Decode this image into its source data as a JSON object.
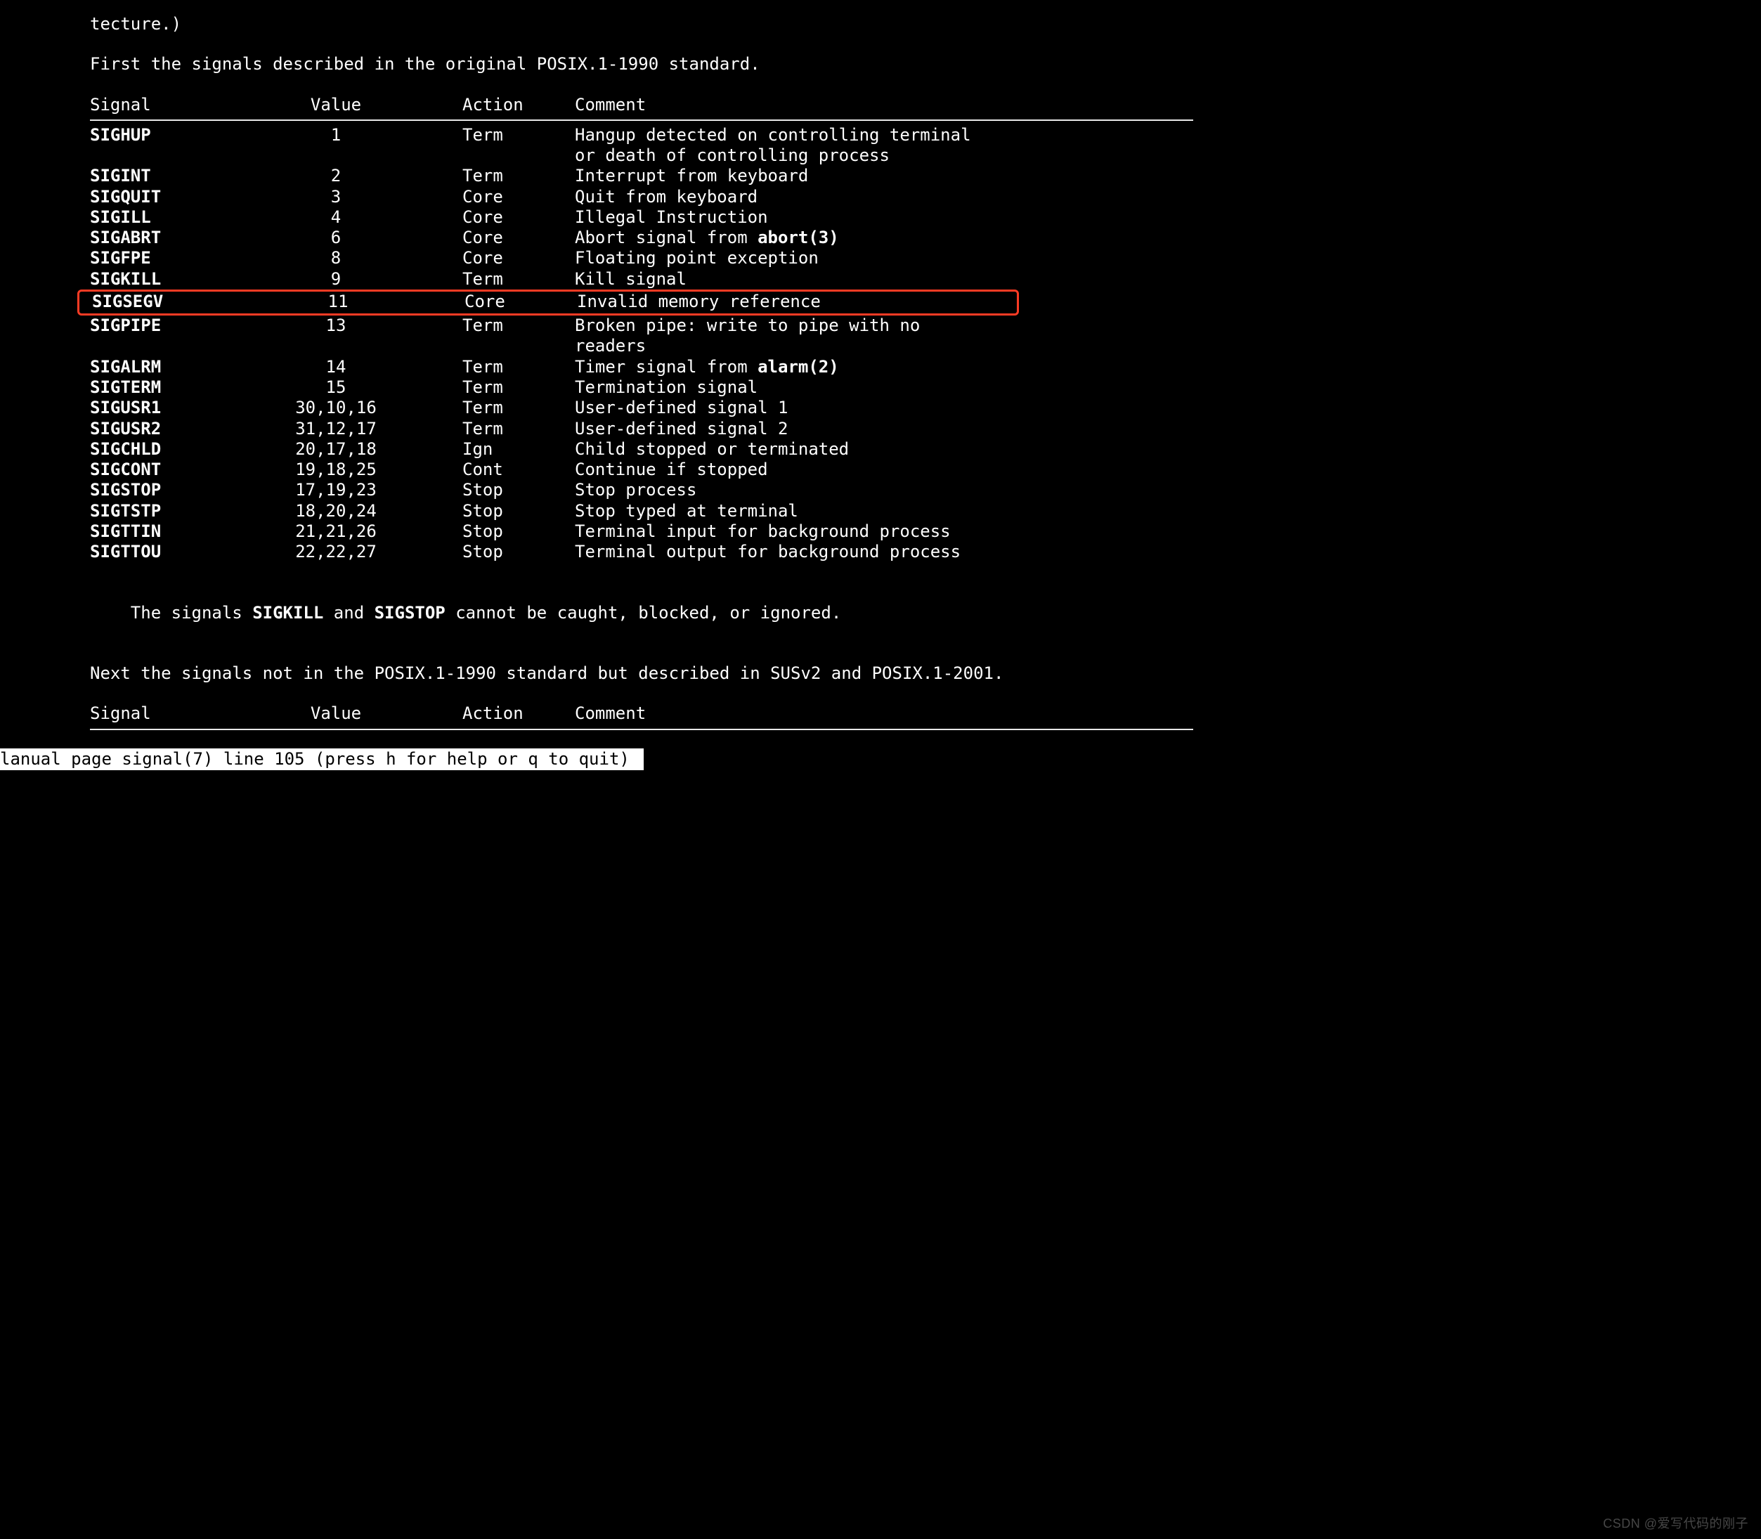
{
  "top_line": "tecture.)",
  "intro": "First the signals described in the original POSIX.1-1990 standard.",
  "headers": {
    "signal": "Signal",
    "value": "Value",
    "action": "Action",
    "comment": "Comment"
  },
  "rows": [
    {
      "signal": "SIGHUP",
      "value": "1",
      "action": "Term",
      "comment": "Hangup detected on controlling terminal",
      "comment2": "or death of controlling process",
      "bold": true
    },
    {
      "signal": "SIGINT",
      "value": "2",
      "action": "Term",
      "comment": "Interrupt from keyboard",
      "bold": true
    },
    {
      "signal": "SIGQUIT",
      "value": "3",
      "action": "Core",
      "comment": "Quit from keyboard",
      "bold": true
    },
    {
      "signal": "SIGILL",
      "value": "4",
      "action": "Core",
      "comment": "Illegal Instruction",
      "bold": true
    },
    {
      "signal": "SIGABRT",
      "value": "6",
      "action": "Core",
      "comment_pre": "Abort signal from ",
      "comment_bold": "abort(3)",
      "bold": true
    },
    {
      "signal": "SIGFPE",
      "value": "8",
      "action": "Core",
      "comment": "Floating point exception",
      "bold": true
    },
    {
      "signal": "SIGKILL",
      "value": "9",
      "action": "Term",
      "comment": "Kill signal",
      "bold": true
    },
    {
      "signal": "SIGSEGV",
      "value": "11",
      "action": "Core",
      "comment": "Invalid memory reference",
      "bold": true,
      "highlight": true
    },
    {
      "signal": "SIGPIPE",
      "value": "13",
      "action": "Term",
      "comment": "Broken pipe: write to pipe with no",
      "comment2": "readers",
      "bold": true
    },
    {
      "signal": "SIGALRM",
      "value": "14",
      "action": "Term",
      "comment_pre": "Timer signal from ",
      "comment_bold": "alarm(2)",
      "bold": true
    },
    {
      "signal": "SIGTERM",
      "value": "15",
      "action": "Term",
      "comment": "Termination signal",
      "bold": true
    },
    {
      "signal": "SIGUSR1",
      "value": "30,10,16",
      "action": "Term",
      "comment": "User-defined signal 1",
      "bold": true
    },
    {
      "signal": "SIGUSR2",
      "value": "31,12,17",
      "action": "Term",
      "comment": "User-defined signal 2",
      "bold": true
    },
    {
      "signal": "SIGCHLD",
      "value": "20,17,18",
      "action": "Ign",
      "comment": "Child stopped or terminated",
      "bold": true
    },
    {
      "signal": "SIGCONT",
      "value": "19,18,25",
      "action": "Cont",
      "comment": "Continue if stopped",
      "bold": true
    },
    {
      "signal": "SIGSTOP",
      "value": "17,19,23",
      "action": "Stop",
      "comment": "Stop process",
      "bold": true
    },
    {
      "signal": "SIGTSTP",
      "value": "18,20,24",
      "action": "Stop",
      "comment": "Stop typed at terminal",
      "bold": true
    },
    {
      "signal": "SIGTTIN",
      "value": "21,21,26",
      "action": "Stop",
      "comment": "Terminal input for background process",
      "bold": true
    },
    {
      "signal": "SIGTTOU",
      "value": "22,22,27",
      "action": "Stop",
      "comment": "Terminal output for background process",
      "bold": true
    }
  ],
  "note_pre": "The signals ",
  "note_b1": "SIGKILL",
  "note_mid": " and ",
  "note_b2": "SIGSTOP",
  "note_post": " cannot be caught, blocked, or ignored.",
  "next_intro": "Next the signals not in the POSIX.1-1990 standard but described in SUSv2 and POSIX.1-2001.",
  "status": "lanual page signal(7) line 105 (press h for help or q to quit) ",
  "watermark": "CSDN @爱写代码的刚子"
}
